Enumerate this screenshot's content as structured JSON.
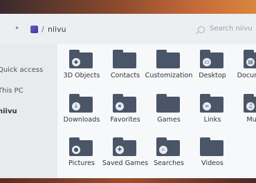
{
  "breadcrumb": {
    "separator": "/",
    "current": "niivu"
  },
  "search": {
    "placeholder": "Search niivu"
  },
  "sidebar": {
    "items": [
      {
        "label": "Quick access"
      },
      {
        "label": "This PC"
      },
      {
        "label": "niivu"
      }
    ]
  },
  "folders": [
    {
      "label": "3D Objects",
      "icon": "cube-icon"
    },
    {
      "label": "Contacts",
      "icon": ""
    },
    {
      "label": "Customization",
      "icon": ""
    },
    {
      "label": "Desktop",
      "icon": "monitor-icon"
    },
    {
      "label": "Documents",
      "icon": "document-icon"
    },
    {
      "label": "Downloads",
      "icon": "download-icon"
    },
    {
      "label": "Favorites",
      "icon": "star-icon"
    },
    {
      "label": "Games",
      "icon": ""
    },
    {
      "label": "Links",
      "icon": "link-icon"
    },
    {
      "label": "Music",
      "icon": "music-icon"
    },
    {
      "label": "Pictures",
      "icon": "palette-icon"
    },
    {
      "label": "Saved Games",
      "icon": "gamepad-icon"
    },
    {
      "label": "Searches",
      "icon": "search-icon"
    },
    {
      "label": "Videos",
      "icon": ""
    }
  ],
  "colors": {
    "folder": "#4a5568",
    "window": "#f2f3f6",
    "sidebar": "#e9eaee"
  }
}
